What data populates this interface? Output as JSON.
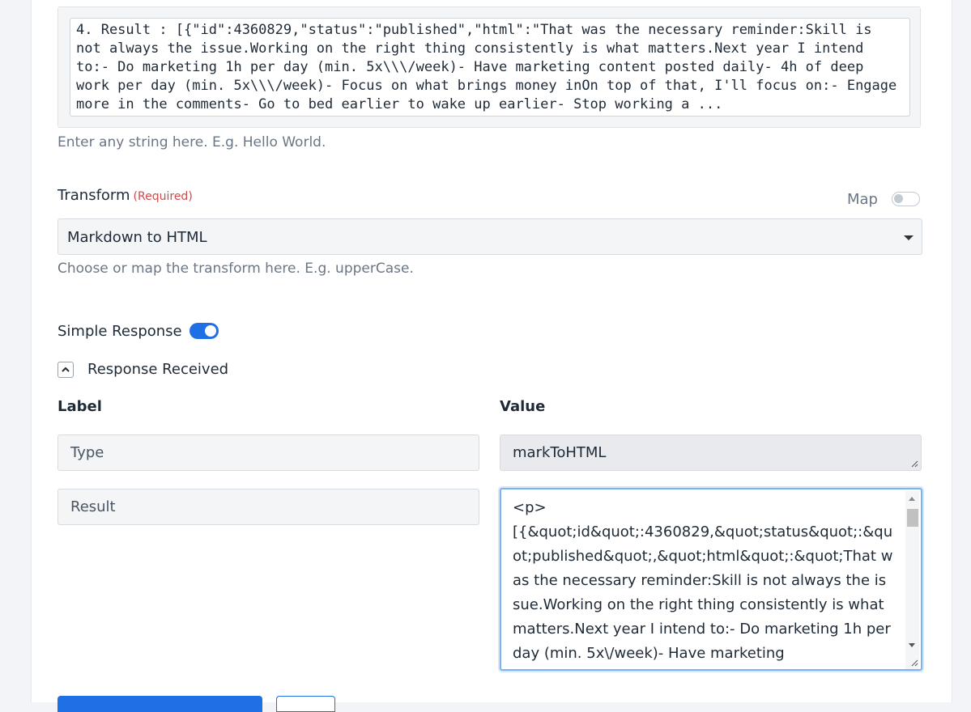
{
  "input": {
    "value": "4. Result : [{\"id\":4360829,\"status\":\"published\",\"html\":\"That was the necessary reminder:Skill is not always the issue.Working on the right thing consistently is what matters.Next year I intend to:- Do marketing 1h per day (min. 5x\\\\\\/week)- Have marketing content posted daily- 4h of deep work per day (min. 5x\\\\\\/week)- Focus on what brings money inOn top of that, I'll focus on:- Engage more in the comments- Go to bed earlier to wake up earlier- Stop working a ...",
    "help": "Enter any string here. E.g. Hello World."
  },
  "transform": {
    "label": "Transform",
    "required": "(Required)",
    "map_label": "Map",
    "map_enabled": false,
    "selected": "Markdown to HTML",
    "help": "Choose or map the transform here. E.g. upperCase."
  },
  "simple_response": {
    "label": "Simple Response",
    "enabled": true
  },
  "response_received": {
    "label": "Response Received",
    "col_label": "Label",
    "col_value": "Value",
    "rows": [
      {
        "label": "Type",
        "value": "markToHTML"
      },
      {
        "label": "Result",
        "value": "<p>\n[{&quot;id&quot;:4360829,&quot;status&quot;:&quot;published&quot;,&quot;html&quot;:&quot;That was the necessary reminder:Skill is not always the issue.Working on the right thing consistently is what matters.Next year I intend to:- Do marketing 1h per day (min. 5x\\/week)- Have marketing"
      }
    ]
  }
}
